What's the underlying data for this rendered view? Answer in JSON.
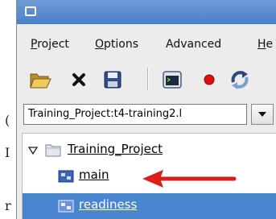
{
  "menu": [
    {
      "label": "Project",
      "mnemonic": "P",
      "rest": "roject"
    },
    {
      "label": "Options",
      "mnemonic": "O",
      "rest": "ptions"
    },
    {
      "label": "Advanced",
      "mnemonic": "",
      "rest": "Advanced"
    },
    {
      "label": "He",
      "mnemonic": "H",
      "rest": "e"
    }
  ],
  "toolbar": {
    "icons": [
      "open-folder-icon",
      "close-x-icon",
      "save-floppy-icon",
      "window-icon",
      "record-dot-icon",
      "refresh-icon"
    ]
  },
  "project_selector": {
    "value": "Training_Project:t4-training2.l"
  },
  "tree": {
    "root": {
      "label": "Training_Project",
      "expanded": true
    },
    "items": [
      {
        "label": "main",
        "selected": false
      },
      {
        "label": "readiness",
        "selected": true
      }
    ]
  },
  "background_chars": [
    "(",
    "I",
    "r"
  ],
  "colors": {
    "titlebar": "#4a7fc8",
    "selection": "#4a86cf",
    "pointer_arrow": "#e01b1b",
    "record": "#e01010"
  }
}
